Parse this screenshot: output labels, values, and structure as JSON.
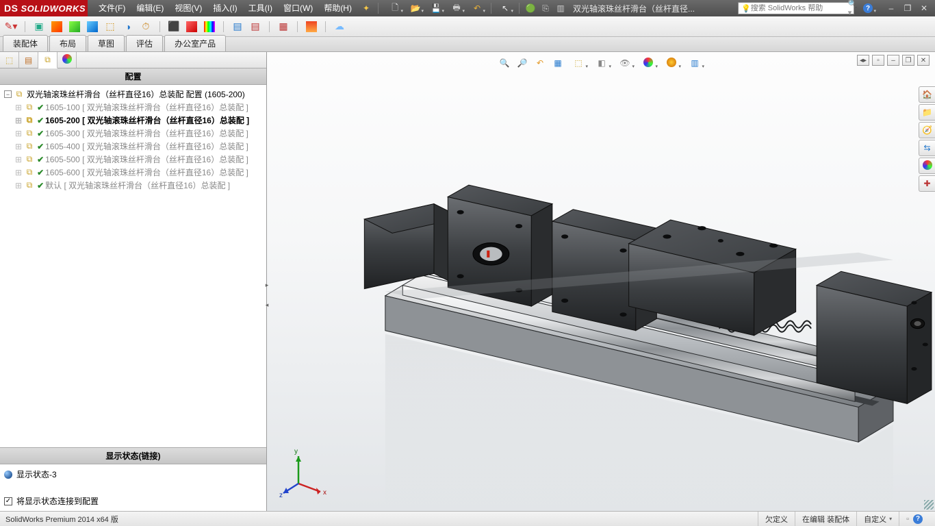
{
  "app": {
    "name": "SOLIDWORKS",
    "ds_prefix": "DS"
  },
  "menu": {
    "file": "文件(F)",
    "edit": "编辑(E)",
    "view": "视图(V)",
    "insert": "插入(I)",
    "tools": "工具(I)",
    "window": "窗口(W)",
    "help": "帮助(H)",
    "assist": "✦"
  },
  "doc_title": "双光轴滚珠丝杆滑台（丝杆直径...",
  "search": {
    "placeholder": "搜索 SolidWorks 帮助"
  },
  "cmd_tabs": {
    "t0": "装配体",
    "t1": "布局",
    "t2": "草图",
    "t3": "评估",
    "t4": "办公室产品"
  },
  "panel": {
    "config_title": "配置",
    "display_title": "显示状态(链接)",
    "link_label": "将显示状态连接到配置",
    "display_state": "显示状态-3"
  },
  "tree": {
    "root": "双光轴滚珠丝杆滑台（丝杆直径16）总装配 配置  (1605-200)",
    "items": [
      {
        "label": "1605-100 [ 双光轴滚珠丝杆滑台（丝杆直径16）总装配 ]",
        "active": false
      },
      {
        "label": "1605-200 [ 双光轴滚珠丝杆滑台（丝杆直径16）总装配 ]",
        "active": true
      },
      {
        "label": "1605-300 [ 双光轴滚珠丝杆滑台（丝杆直径16）总装配 ]",
        "active": false
      },
      {
        "label": "1605-400 [ 双光轴滚珠丝杆滑台（丝杆直径16）总装配 ]",
        "active": false
      },
      {
        "label": "1605-500 [ 双光轴滚珠丝杆滑台（丝杆直径16）总装配 ]",
        "active": false
      },
      {
        "label": "1605-600 [ 双光轴滚珠丝杆滑台（丝杆直径16）总装配 ]",
        "active": false
      },
      {
        "label": "默认 [ 双光轴滚珠丝杆滑台（丝杆直径16）总装配 ]",
        "active": false
      }
    ]
  },
  "triad": {
    "x": "x",
    "y": "y",
    "z": "z"
  },
  "status": {
    "product": "SolidWorks Premium 2014 x64 版",
    "under_defined": "欠定义",
    "editing": "在编辑 装配体",
    "custom": "自定义",
    "help": "?"
  },
  "icons": {
    "new": "🗋",
    "open": "📂",
    "save": "💾",
    "print": "🖶",
    "undo": "↶",
    "redo": "↷",
    "select": "↖",
    "rebuild": "🟢",
    "options": "⎘",
    "pane": "▥",
    "help": "?",
    "min": "–",
    "max": "❐",
    "close": "✕",
    "zoomfit": "🔍",
    "zoomarea": "🔎",
    "prev": "↩",
    "section": "▦",
    "viewori": "⬚",
    "display": "◧",
    "scene": "☀",
    "appear": "🎨",
    "setting": "⚙",
    "home": "🏠",
    "chart": "📊",
    "clip": "📎",
    "arrows": "⇆",
    "gear": "⚙"
  }
}
